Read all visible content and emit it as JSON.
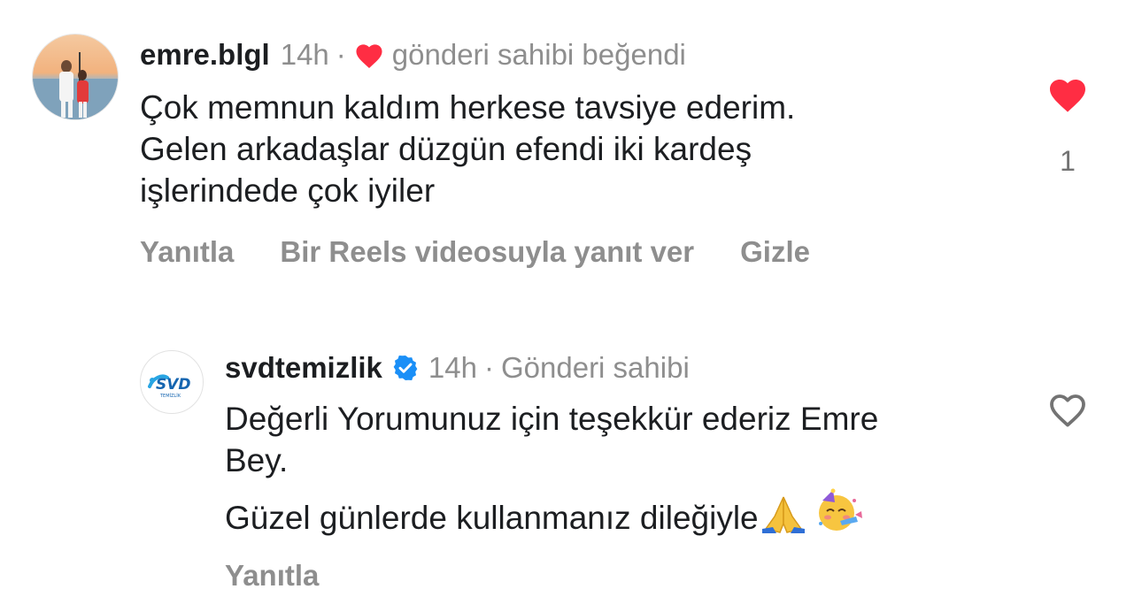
{
  "colors": {
    "like_red": "#ff2d43",
    "verified_blue": "#1a8ff7",
    "muted_gray": "#8e8e8e",
    "text": "#1c1e21"
  },
  "comments": [
    {
      "username": "emre.blgl",
      "time": "14h",
      "separator": "·",
      "liked_by_author_icon": "heart-filled-red",
      "liked_by_author_text": "gönderi sahibi beğendi",
      "text_lines": [
        "Çok memnun kaldım herkese tavsiye ederim.",
        "Gelen arkadaşlar düzgün efendi iki kardeş",
        "işlerindede çok iyiler"
      ],
      "like_icon": "heart-filled",
      "liked": true,
      "like_count": "1",
      "actions": {
        "reply": "Yanıtla",
        "reels_reply": "Bir Reels videosuyla yanıt ver",
        "hide": "Gizle"
      }
    },
    {
      "username": "svdtemizlik",
      "verified_icon": "verified-badge",
      "time": "14h",
      "separator": "·",
      "author_label": "Gönderi sahibi",
      "avatar_logo_text": "SVD",
      "avatar_logo_subtext": "TEMİZLİK",
      "text_lines": [
        "Değerli Yorumunuz için teşekkür ederiz Emre",
        "Bey."
      ],
      "text_line_2": "Güzel günlerde kullanmanız dileğiyle",
      "emojis": [
        "folded-hands-emoji",
        "partying-face-emoji"
      ],
      "like_icon": "heart-outline",
      "liked": false,
      "actions": {
        "reply": "Yanıtla"
      }
    }
  ]
}
